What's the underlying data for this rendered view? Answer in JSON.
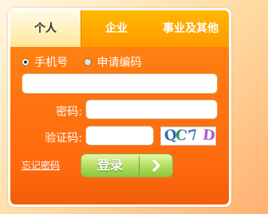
{
  "tabs": {
    "personal": "个人",
    "enterprise": "企业",
    "institution": "事业及其他"
  },
  "login_mode": {
    "phone": "手机号",
    "application_code": "申请编码",
    "selected": "手机号"
  },
  "fields": {
    "account_value": "",
    "password_label": "密码:",
    "password_value": "",
    "captcha_label": "验证码:",
    "captcha_value": ""
  },
  "captcha": {
    "chars": [
      "Q",
      "C",
      "7",
      "D"
    ],
    "colors": [
      "#2e6fb0",
      "#3a8f6e",
      "#4a7fc8",
      "#b05cc8"
    ]
  },
  "links": {
    "forgot_password": "忘记密码"
  },
  "buttons": {
    "login": "登录"
  },
  "colors": {
    "panel_orange": "#ff7410",
    "tab_gold": "#ffb800",
    "button_green": "#b8e06a"
  }
}
